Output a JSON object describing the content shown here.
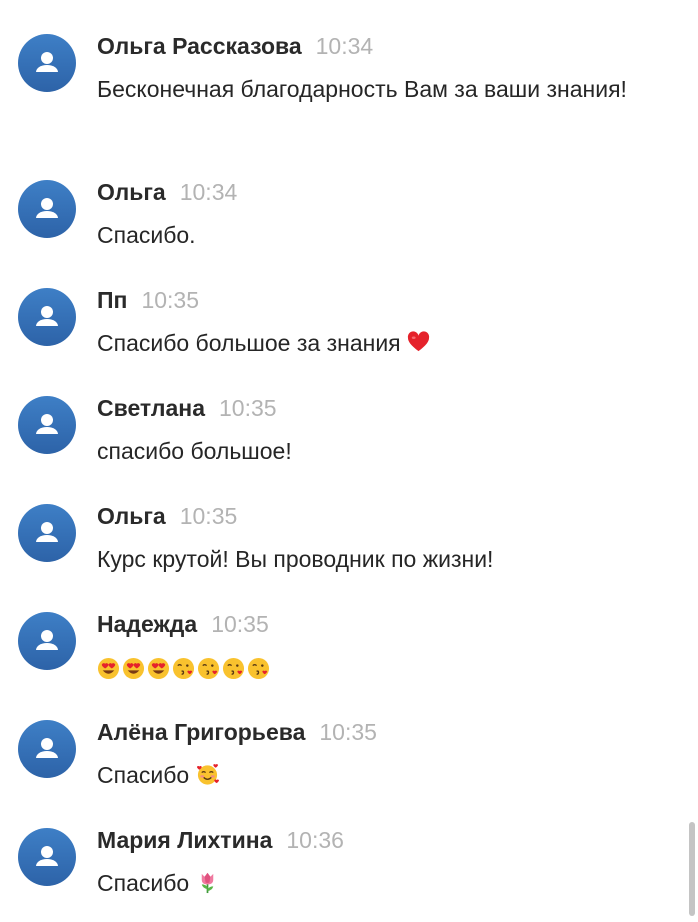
{
  "messages": [
    {
      "author": "Ольга Рассказова",
      "time": "10:34",
      "text": "Бесконечная благодарность Вам за ваши знания!",
      "emoji": []
    },
    {
      "author": "Ольга",
      "time": "10:34",
      "text": "Спасибо.",
      "emoji": []
    },
    {
      "author": "Пп",
      "time": "10:35",
      "text": "Спасибо большое за знания",
      "emoji": [
        "red-heart"
      ]
    },
    {
      "author": "Светлана",
      "time": "10:35",
      "text": "спасибо большое!",
      "emoji": []
    },
    {
      "author": "Ольга",
      "time": "10:35",
      "text": "Курс крутой! Вы проводник по жизни!",
      "emoji": []
    },
    {
      "author": "Надежда",
      "time": "10:35",
      "text": "",
      "emoji": [
        "heart-eyes-face",
        "heart-eyes-face",
        "heart-eyes-face",
        "kissing-face",
        "kissing-face",
        "kissing-face",
        "kissing-face"
      ]
    },
    {
      "author": "Алёна Григорьева",
      "time": "10:35",
      "text": "Спасибо",
      "emoji": [
        "smiling-face-with-hearts"
      ]
    },
    {
      "author": "Мария Лихтина",
      "time": "10:36",
      "text": "Спасибо",
      "emoji": [
        "tulip"
      ]
    }
  ],
  "colors": {
    "avatar": "#3a74bb",
    "author": "#2a2a2a",
    "time": "#b3b3b3",
    "text": "#262626"
  }
}
